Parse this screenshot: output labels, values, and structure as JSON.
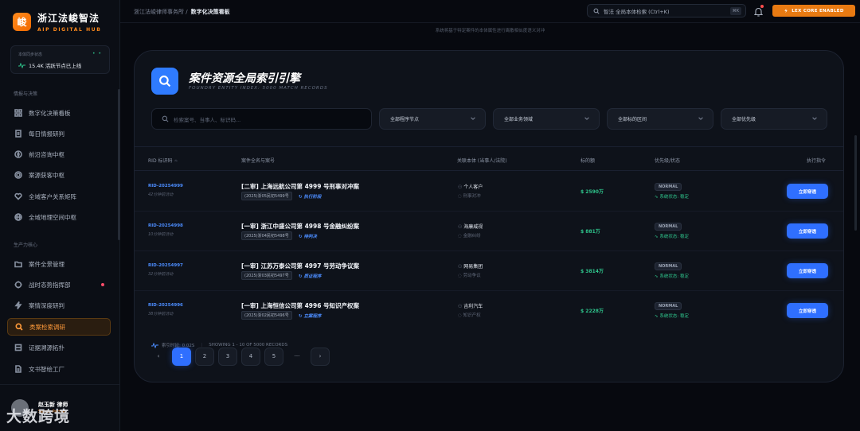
{
  "brand": {
    "logo_char": "峻",
    "name": "浙江法峻智法",
    "sub": "AIP DIGITAL HUB"
  },
  "sync": {
    "title": "本体同步状态",
    "indicator": "• •",
    "value": "15.4K 活跃节点已上线"
  },
  "sections": {
    "intel": "情报与决策",
    "prod": "生产力核心"
  },
  "nav": [
    {
      "label": "数字化决策看板",
      "icon": "grid-icon"
    },
    {
      "label": "每日情报研判",
      "icon": "document-icon"
    },
    {
      "label": "前沿咨询中枢",
      "icon": "compass-icon"
    },
    {
      "label": "案源获客中枢",
      "icon": "target-icon"
    },
    {
      "label": "全域客户关系矩阵",
      "icon": "heart-icon"
    },
    {
      "label": "全域地理空间中枢",
      "icon": "globe-icon"
    },
    {
      "label": "案件全景管理",
      "icon": "folder-icon"
    },
    {
      "label": "战时态势指挥部",
      "icon": "crosshair-icon"
    },
    {
      "label": "案情深度研判",
      "icon": "bolt-icon"
    },
    {
      "label": "类案检索调研",
      "icon": "search-icon"
    },
    {
      "label": "证据溯源拓扑",
      "icon": "layers-icon"
    },
    {
      "label": "文书智绘工厂",
      "icon": "file-icon"
    }
  ],
  "user": {
    "name": "赵玉新 律师",
    "org": "Senior Partner"
  },
  "watermark": "大数跨境",
  "topbar": {
    "crumb_parent": "浙江法峻律师事务所 /",
    "crumb_current": "数字化决策看板",
    "search_placeholder": "智法 全局本体检索 (Ctrl+K)",
    "kbd": "⌘K",
    "lex_label": "LEX CORE ENABLED"
  },
  "note": "系统将基于特定案件的本体属性进行离散相似度语义对冲",
  "panel": {
    "title": "案件资源全局索引引擎",
    "subtitle": "FOUNDRY ENTITY INDEX: 5000 MATCH RECORDS",
    "search_placeholder": "检索案号、当事人、标识码...",
    "filters": [
      "全部程序节点",
      "全部业务领域",
      "全部标的区间",
      "全部优先级"
    ]
  },
  "table": {
    "headers": {
      "rid": "RID 标识码",
      "case": "案件全名与案号",
      "party": "关联本体 (当事人/法院)",
      "amount": "标的额",
      "priority": "优先级/状态",
      "action": "执行指令"
    },
    "rows": [
      {
        "rid": "RID-20254999",
        "time": "42分钟前活动",
        "name": "[二审] 上海远航公司第 4999 号刑事对冲案",
        "no": "(2025)浙05民初5499号",
        "stage": "执行阶段",
        "party": "个人客户",
        "domain": "刑事对冲",
        "amount": "2590万",
        "badge": "NORMAL",
        "status": "系统状态: 稳定",
        "action": "立即穿透"
      },
      {
        "rid": "RID-20254998",
        "time": "10分钟前活动",
        "name": "[一审] 浙江中盛公司第 4998 号金融纠纷案",
        "no": "(2025)浙04民初5498号",
        "stage": "待判决",
        "party": "海康威视",
        "domain": "金融纠纷",
        "amount": "881万",
        "badge": "NORMAL",
        "status": "系统状态: 稳定",
        "action": "立即穿透"
      },
      {
        "rid": "RID-20254997",
        "time": "32分钟前活动",
        "name": "[一审] 江苏万泰公司第 4997 号劳动争议案",
        "no": "(2025)浙03民初5497号",
        "stage": "质证程序",
        "party": "网易集团",
        "domain": "劳动争议",
        "amount": "3814万",
        "badge": "NORMAL",
        "status": "系统状态: 稳定",
        "action": "立即穿透"
      },
      {
        "rid": "RID-20254996",
        "time": "38分钟前活动",
        "name": "[一审] 上海恒信公司第 4996 号知识产权案",
        "no": "(2025)浙02民初5496号",
        "stage": "立案程序",
        "party": "吉利汽车",
        "domain": "知识产权",
        "amount": "2228万",
        "badge": "NORMAL",
        "status": "系统状态: 稳定",
        "action": "立即穿透"
      }
    ]
  },
  "footer": {
    "latency": "索引时延: 0.02S",
    "showing": "SHOWING 1 - 10 OF 5000 RECORDS"
  },
  "pager": {
    "prev": "‹",
    "pages": [
      "1",
      "2",
      "3",
      "4",
      "5"
    ],
    "ellipsis": "···",
    "next": "›"
  },
  "colors": {
    "accent_orange": "#ff8a1d",
    "accent_blue": "#2f6fff",
    "success": "#2ec28a"
  }
}
